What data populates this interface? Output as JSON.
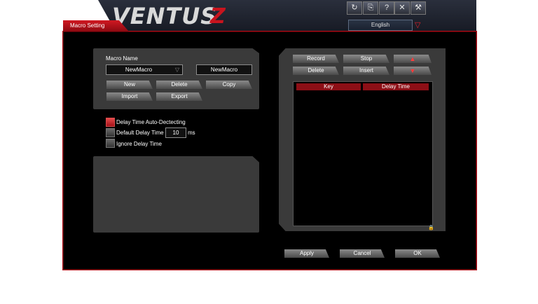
{
  "header": {
    "logo_text": "VENTUS",
    "logo_suffix": "Z",
    "icons": [
      "refresh-icon",
      "save-icon",
      "help-icon",
      "close-icon",
      "tools-icon"
    ],
    "icon_glyphs": [
      "↻",
      "⎘",
      "?",
      "✕",
      "⚒"
    ],
    "language": "English"
  },
  "window": {
    "title": "Macro Setting"
  },
  "macro": {
    "name_label": "Macro Name",
    "selected_macro": "NewMacro",
    "name_value": "NewMacro",
    "buttons": {
      "new": "New",
      "delete": "Delete",
      "copy": "Copy",
      "import": "Import",
      "export": "Export"
    }
  },
  "options": {
    "auto_detect_label": "Delay Time Auto-Dectecting",
    "auto_detect_checked": true,
    "default_delay_label": "Default Delay Time",
    "default_delay_checked": false,
    "default_delay_value": "10",
    "default_delay_unit": "ms",
    "ignore_delay_label": "Ignore Delay Time",
    "ignore_delay_checked": false
  },
  "recorder": {
    "record": "Record",
    "stop": "Stop",
    "delete": "Delete",
    "insert": "Insert",
    "columns": [
      "Key",
      "Delay Time"
    ]
  },
  "footer": {
    "apply": "Apply",
    "cancel": "Cancel",
    "ok": "OK"
  },
  "colors": {
    "accent": "#c8141e",
    "panel": "#3a3a3a",
    "header_column": "#8d0f16"
  }
}
